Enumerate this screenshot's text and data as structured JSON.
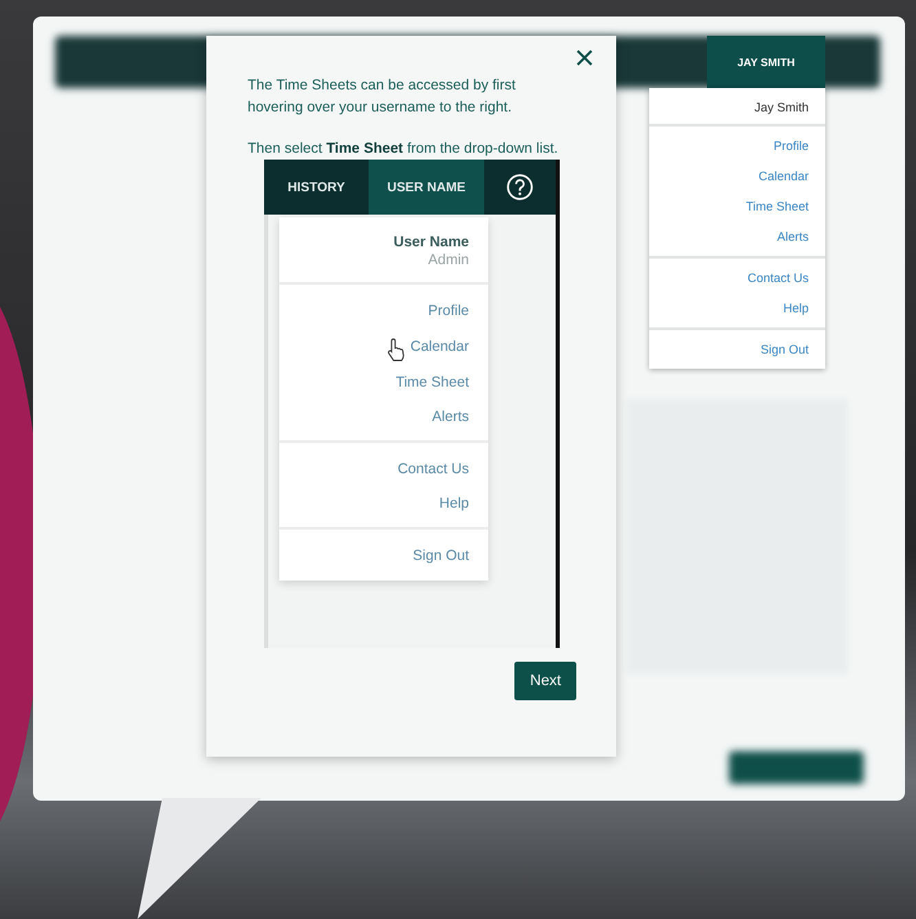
{
  "tutorial": {
    "paragraphs": [
      "The Time Sheets can be accessed by first hovering over your username to the right.",
      "Then select **Time Sheet** from the drop-down list."
    ],
    "preview": {
      "nav": [
        {
          "label": "HISTORY",
          "selected": false
        },
        {
          "label": "USER NAME",
          "selected": true
        }
      ],
      "user": {
        "name": "User Name",
        "role": "Admin"
      },
      "menu_groups": [
        [
          "Profile",
          "Calendar",
          "Time Sheet",
          "Alerts"
        ],
        [
          "Contact Us",
          "Help"
        ],
        [
          "Sign Out"
        ]
      ]
    },
    "next_button": "Next"
  },
  "app": {
    "user_tab": {
      "label": "JAY SMITH",
      "selected": true
    },
    "menu": {
      "user": "Jay Smith",
      "groups": [
        [
          "Profile",
          "Calendar",
          "Time Sheet",
          "Alerts"
        ],
        [
          "Contact Us",
          "Help"
        ],
        [
          "Sign Out"
        ]
      ]
    }
  }
}
